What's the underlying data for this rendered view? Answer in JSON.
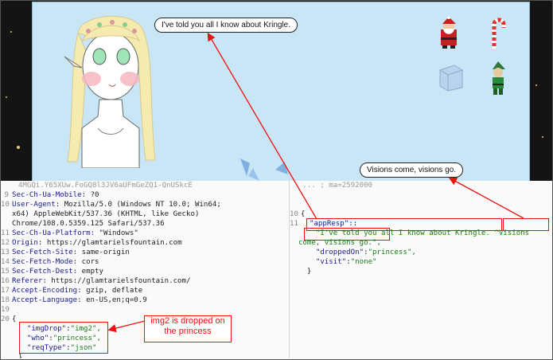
{
  "game": {
    "bubble_princess": "I've told you all I know about Kringle.",
    "bubble_visions": "Visions come, visions go.",
    "items": [
      "santa-icon",
      "candy-cane-icon",
      "ice-cube-icon",
      "elf-icon"
    ]
  },
  "request": {
    "lines": [
      {
        "n": "",
        "t": "4MGQi.Y65XUw.FoGQ8l3JV6aUFmGeZQ1-QnUSkcE"
      },
      {
        "n": "9",
        "key": "Sec-Ch-Ua-Mobile",
        "val": " ?0"
      },
      {
        "n": "10",
        "key": "User-Agent",
        "val": " Mozilla/5.0 (Windows NT 10.0; Win64;"
      },
      {
        "n": "",
        "t": "x64) AppleWebKit/537.36 (KHTML, like Gecko)"
      },
      {
        "n": "",
        "t": "Chrome/108.0.5359.125 Safari/537.36"
      },
      {
        "n": "11",
        "key": "Sec-Ch-Ua-Platform",
        "val": " \"Windows\""
      },
      {
        "n": "12",
        "key": "Origin",
        "val": " https://glamtarielsfountain.com"
      },
      {
        "n": "13",
        "key": "Sec-Fetch-Site",
        "val": " same-origin"
      },
      {
        "n": "14",
        "key": "Sec-Fetch-Mode",
        "val": " cors"
      },
      {
        "n": "15",
        "key": "Sec-Fetch-Dest",
        "val": " empty"
      },
      {
        "n": "16",
        "key": "Referer",
        "val": " https://glamtarielsfountain.com/"
      },
      {
        "n": "17",
        "key": "Accept-Encoding",
        "val": " gzip, deflate"
      },
      {
        "n": "18",
        "key": "Accept-Language",
        "val": " en-US,en;q=0.9"
      },
      {
        "n": "19",
        "t": ""
      },
      {
        "n": "20",
        "t": "{"
      }
    ],
    "body": [
      {
        "key": "\"imgDrop\"",
        "val": "\"img2\","
      },
      {
        "key": "\"who\"",
        "val": "\"princess\","
      },
      {
        "key": "\"reqType\"",
        "val": "\"json\""
      }
    ],
    "close": "}",
    "note": "img2 is dropped on the princess"
  },
  "response": {
    "top_partial": "ma=2592000",
    "lines": [
      {
        "n": "10",
        "t": "{"
      },
      {
        "n": "11",
        "t": "  \"appResp\":"
      }
    ],
    "appResp_1": "\"I've told you all I know about Kringle.",
    "appResp_2": "^Visions",
    "appResp_3": "come, visions go.",
    "appResp_4": "\",",
    "droppedOn_key": "\"droppedOn\"",
    "droppedOn_val": "\"princess\",",
    "visit_key": "\"visit\"",
    "visit_val": "\"none\"",
    "close": "}"
  },
  "colors": {
    "annotation": "#ee1111",
    "game_bg": "#c9e6f7"
  }
}
